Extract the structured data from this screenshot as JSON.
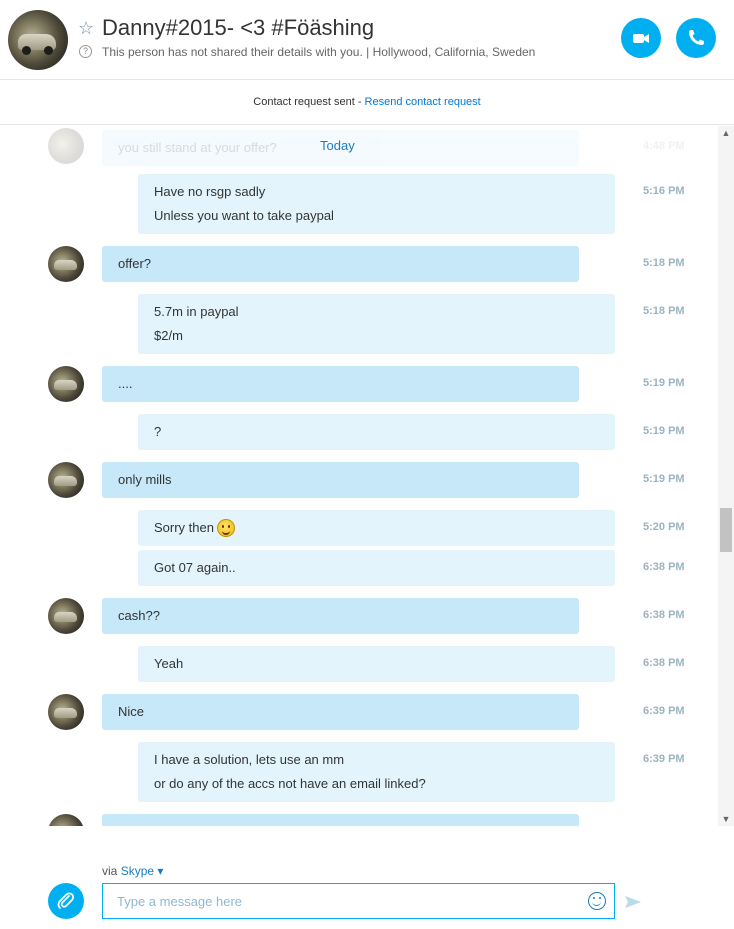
{
  "header": {
    "name": "Danny#2015- <3 #Föäshing",
    "subtitle": "This person has not shared their details with you.  |  Hollywood, California, Sweden",
    "star_icon": "star-icon",
    "info_icon": "?"
  },
  "request_bar": {
    "text": "Contact request sent - ",
    "link": "Resend contact request"
  },
  "chat": {
    "faded_text": "you still stand at your offer?",
    "faded_time": "4:48 PM",
    "date_divider": "Today",
    "messages": [
      {
        "dir": "out",
        "lines": [
          "Have no rsgp sadly",
          "Unless you want to take paypal"
        ],
        "time": "5:16 PM"
      },
      {
        "dir": "in",
        "lines": [
          "offer?"
        ],
        "time": "5:18 PM"
      },
      {
        "dir": "out",
        "lines": [
          "5.7m in paypal",
          "$2/m"
        ],
        "time": "5:18 PM"
      },
      {
        "dir": "in",
        "lines": [
          "...."
        ],
        "time": "5:19 PM"
      },
      {
        "dir": "out",
        "lines": [
          "?"
        ],
        "time": "5:19 PM"
      },
      {
        "dir": "in",
        "lines": [
          "only mills"
        ],
        "time": "5:19 PM"
      },
      {
        "dir": "out",
        "lines": [
          "Sorry then"
        ],
        "time": "5:20 PM",
        "emoji": "smile"
      },
      {
        "dir": "out",
        "lines": [
          "Got 07 again.."
        ],
        "time": "6:38 PM"
      },
      {
        "dir": "in",
        "lines": [
          "cash??"
        ],
        "time": "6:38 PM"
      },
      {
        "dir": "out",
        "lines": [
          "Yeah"
        ],
        "time": "6:38 PM"
      },
      {
        "dir": "in",
        "lines": [
          "Nice"
        ],
        "time": "6:39 PM"
      },
      {
        "dir": "out",
        "lines": [
          "I have a solution, lets use an mm",
          "or do any of the accs not have an email linked?"
        ],
        "time": "6:39 PM"
      }
    ]
  },
  "composer": {
    "via_label": "via ",
    "via_service": "Skype",
    "placeholder": "Type a message here"
  },
  "colors": {
    "accent": "#00aff0",
    "incoming_bubble": "#c7e8f9",
    "outgoing_bubble": "#e3f4fc",
    "link": "#1a7dc4"
  }
}
